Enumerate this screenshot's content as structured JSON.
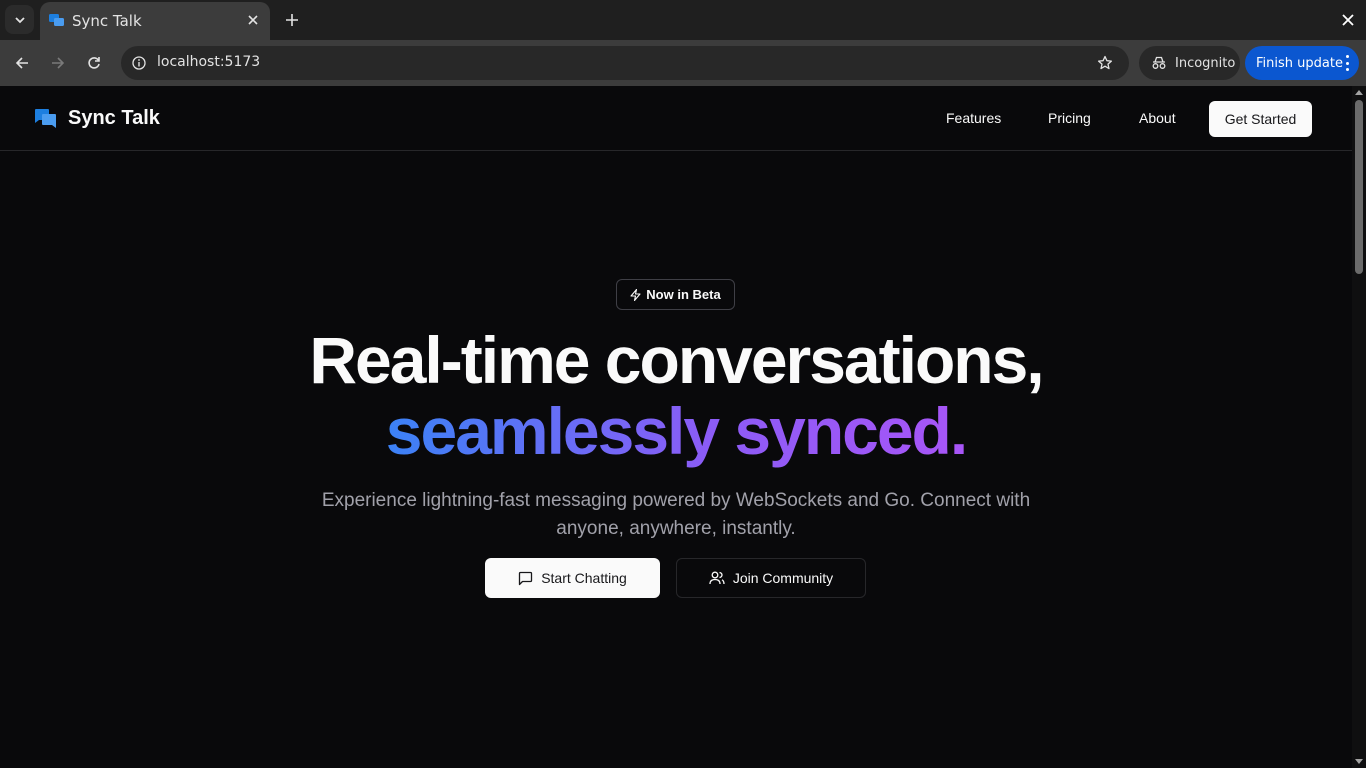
{
  "browser": {
    "tab": {
      "title": "Sync Talk",
      "favicon": "chat-bubbles-icon"
    },
    "url": "localhost:5173",
    "incognito_label": "Incognito",
    "update_label": "Finish update",
    "icons": [
      "tab-list-icon",
      "close-icon",
      "plus-icon",
      "back-icon",
      "forward-icon",
      "reload-icon",
      "site-info-icon",
      "star-icon",
      "incognito-icon",
      "kebab-menu-icon"
    ]
  },
  "site": {
    "brand": "Sync Talk",
    "nav": [
      "Features",
      "Pricing",
      "About"
    ],
    "cta": "Get Started",
    "badge": "Now in Beta",
    "headline_line1": "Real-time conversations,",
    "headline_line2": "seamlessly synced.",
    "subtitle": "Experience lightning-fast messaging powered by WebSockets and Go. Connect with anyone, anywhere, instantly.",
    "primary_button": "Start Chatting",
    "secondary_button": "Join Community"
  },
  "colors": {
    "background": "#09090b",
    "gradient_start": "#3b82f6",
    "gradient_end": "#a855f7",
    "chrome_accent": "#0b57d0"
  }
}
